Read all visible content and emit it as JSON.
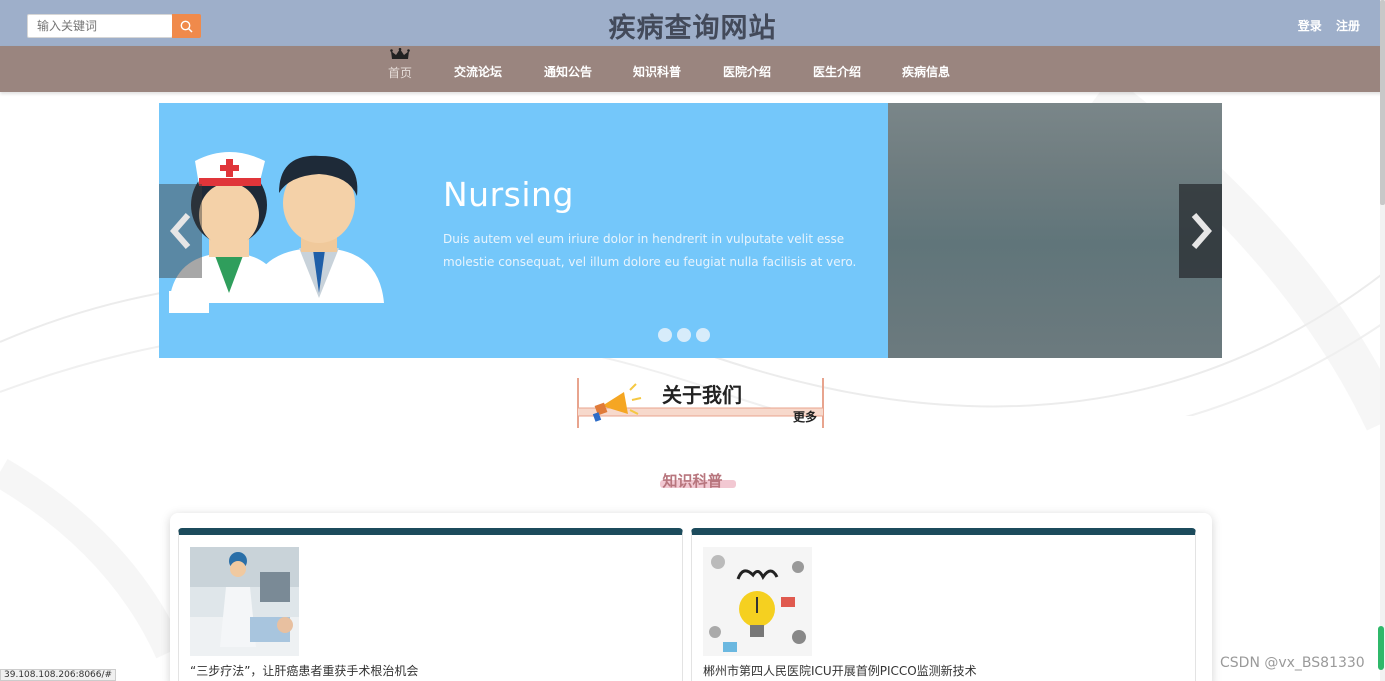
{
  "header": {
    "site_title": "疾病查询网站",
    "search_placeholder": "输入关键词",
    "login_label": "登录",
    "register_label": "注册"
  },
  "nav": {
    "items": [
      {
        "label": "首页"
      },
      {
        "label": "交流论坛"
      },
      {
        "label": "通知公告"
      },
      {
        "label": "知识科普"
      },
      {
        "label": "医院介绍"
      },
      {
        "label": "医生介绍"
      },
      {
        "label": "疾病信息"
      }
    ]
  },
  "banner": {
    "title": "Nursing",
    "text": "Duis autem vel eum iriure dolor in hendrerit in vulputate velit esse molestie consequat, vel illum dolore eu feugiat nulla facilisis at vero.",
    "slide_count": 3
  },
  "about": {
    "title": "关于我们",
    "more_label": "更多"
  },
  "knowledge": {
    "section_title": "知识科普",
    "cards": [
      {
        "title": "“三步疗法”，让肝癌患者重获手术根治机会"
      },
      {
        "title": "郴州市第四人民医院ICU开展首例PICCO监测新技术"
      }
    ]
  },
  "status_bar": {
    "url": "39.108.108.206:8066/#"
  },
  "watermark": "CSDN @vx_BS81330",
  "colors": {
    "topbar": "#9eafca",
    "navbar": "#9a857f",
    "banner": "#74c7fa",
    "search_button": "#f08a4b",
    "card_header": "#1c4b5c"
  },
  "icons": [
    "search-icon",
    "crown-icon",
    "chevron-left-icon",
    "chevron-right-icon",
    "megaphone-icon",
    "nurse-illustration",
    "doctor-illustration"
  ]
}
